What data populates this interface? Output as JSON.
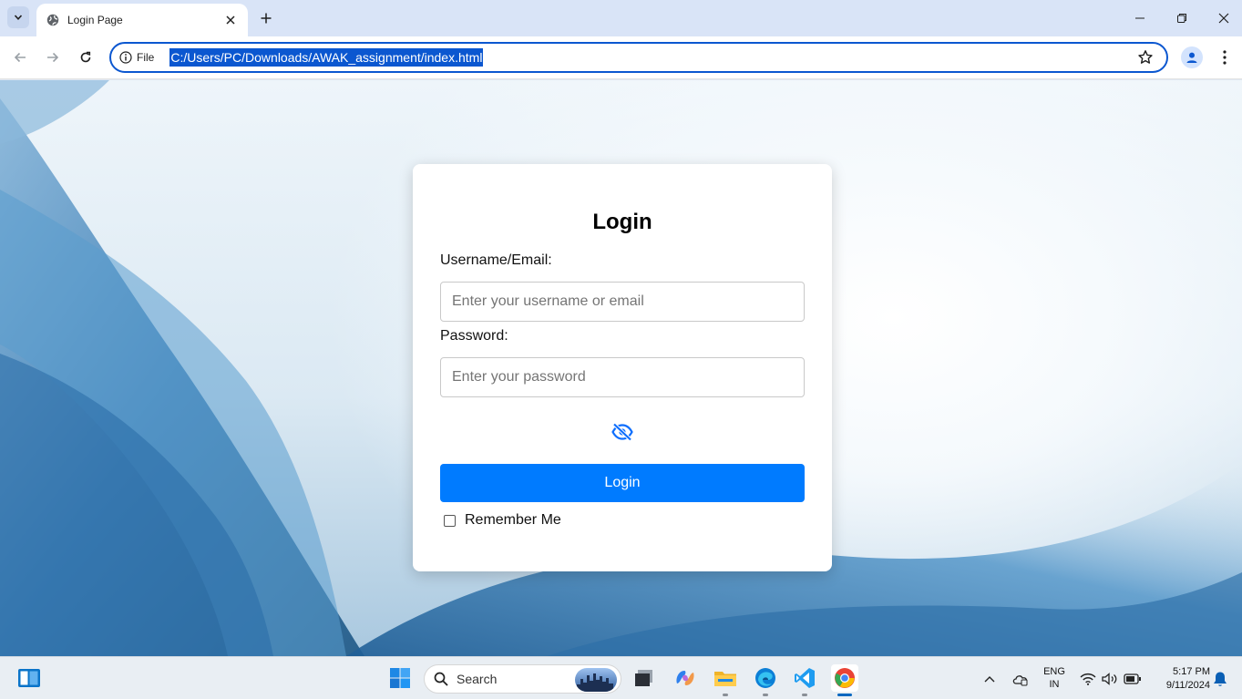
{
  "browser": {
    "tab": {
      "title": "Login Page"
    },
    "address_bar": {
      "site_label": "File",
      "url": "C:/Users/PC/Downloads/AWAK_assignment/index.html"
    }
  },
  "login_form": {
    "title": "Login",
    "username": {
      "label": "Username/Email:",
      "placeholder": "Enter your username or email",
      "value": ""
    },
    "password": {
      "label": "Password:",
      "placeholder": "Enter your password",
      "value": ""
    },
    "toggle_icon": "eye-slash-icon",
    "submit_label": "Login",
    "remember": {
      "label": "Remember Me",
      "checked": false
    },
    "accent_color": "#007bff"
  },
  "taskbar": {
    "search_label": "Search",
    "apps": [
      "start",
      "search",
      "task-view",
      "copilot",
      "file-explorer",
      "edge",
      "vscode",
      "chrome"
    ],
    "language": {
      "line1": "ENG",
      "line2": "IN"
    },
    "time": "5:17 PM",
    "date": "9/11/2024"
  }
}
